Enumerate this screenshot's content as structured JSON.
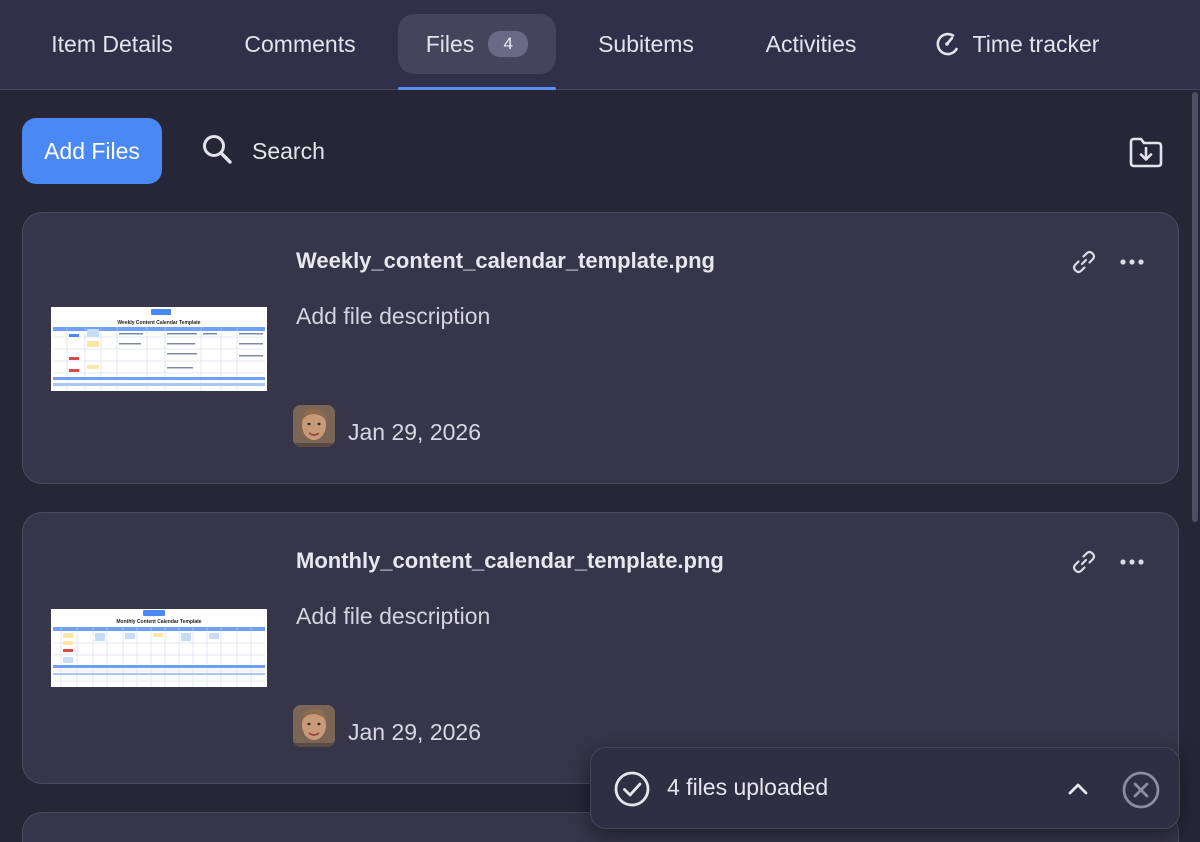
{
  "tabs": [
    {
      "label": "Item Details"
    },
    {
      "label": "Comments"
    },
    {
      "label": "Files",
      "badge": "4"
    },
    {
      "label": "Subitems"
    },
    {
      "label": "Activities"
    },
    {
      "label": "Time tracker"
    }
  ],
  "active_tab": "Files",
  "toolbar": {
    "add_files_label": "Add Files",
    "search_placeholder": "Search",
    "download_icon": "folder-download-icon"
  },
  "files": [
    {
      "name": "Weekly_content_calendar_template.png",
      "description_placeholder": "Add file description",
      "date": "Jan 29, 2026",
      "thumbnail_title": "Weekly Content Calendar Template"
    },
    {
      "name": "Monthly_content_calendar_template.png",
      "description_placeholder": "Add file description",
      "date": "Jan 29, 2026",
      "thumbnail_title": "Monthly Content Calendar Template"
    }
  ],
  "toast": {
    "message": "4 files uploaded"
  },
  "colors": {
    "background": "#272637",
    "card": "#363549",
    "accent": "#4a89f3",
    "tab_active": "#44445c"
  }
}
